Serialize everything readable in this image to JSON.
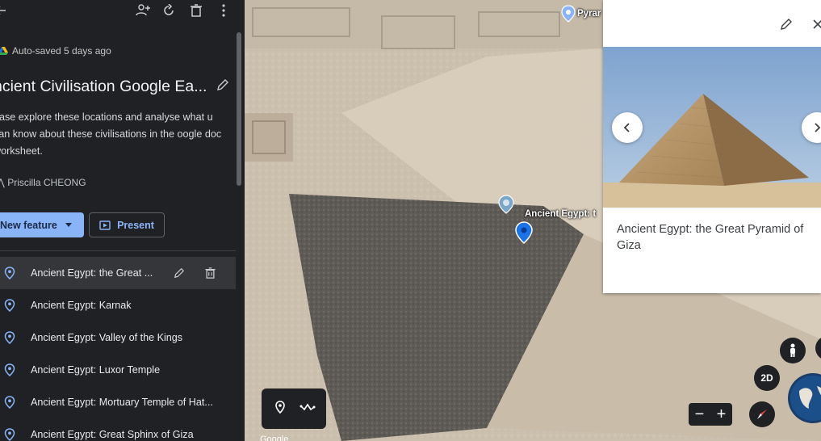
{
  "panel": {
    "autosave_text": "Auto-saved 5 days ago",
    "title": "ncient Civilisation Google Ea...",
    "description": "ease explore these locations and analyse what u can know about these civilisations in the oogle doc worksheet.",
    "author": "Priscilla CHEONG",
    "new_feature_label": "New feature",
    "present_label": "Present",
    "items": [
      {
        "label": "Ancient Egypt: the Great ..."
      },
      {
        "label": "Ancient Egypt: Karnak"
      },
      {
        "label": "Ancient Egypt: Valley of the Kings"
      },
      {
        "label": "Ancient Egypt: Luxor Temple"
      },
      {
        "label": "Ancient Egypt: Mortuary Temple of Hat..."
      },
      {
        "label": "Ancient Egypt: Great Sphinx of Giza"
      }
    ]
  },
  "map": {
    "label_top": "Pyrar",
    "label_pin": "Ancient Egypt: t",
    "view_mode": "2D",
    "attribution": "Google"
  },
  "card": {
    "title": "Ancient Egypt: the Great Pyramid of Giza"
  },
  "colors": {
    "panel_bg": "#202124",
    "accent": "#8ab4f8",
    "pin_blue": "#1a73e8"
  }
}
